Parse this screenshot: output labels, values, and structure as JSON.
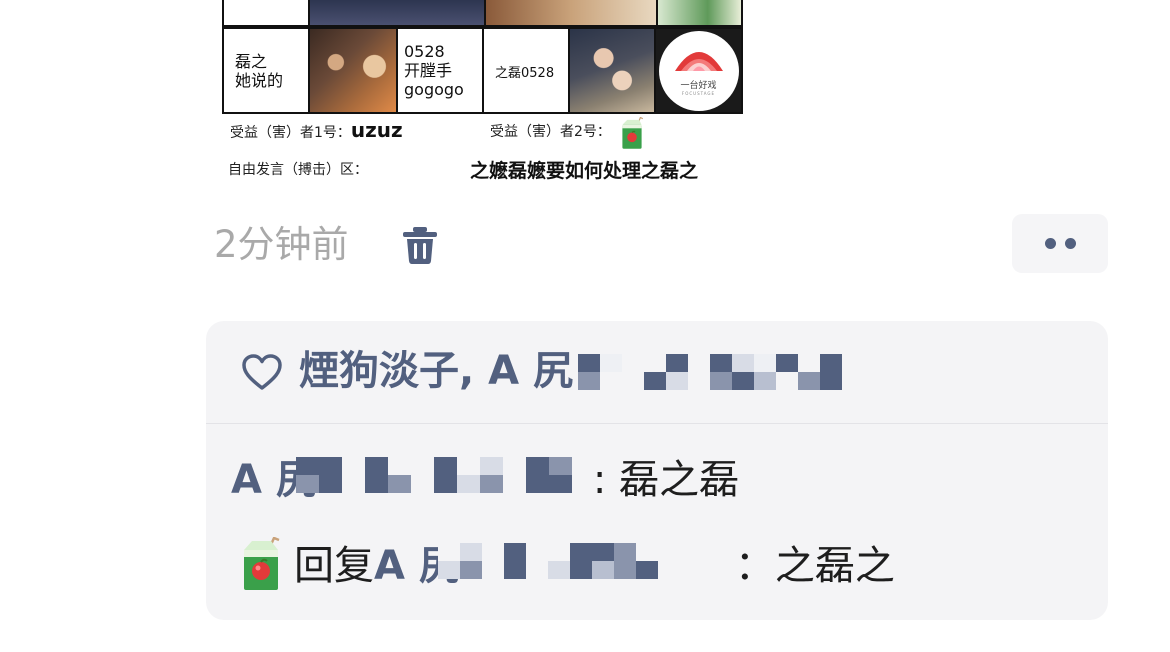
{
  "meme": {
    "cells": [
      {
        "text": "磊之\n她说的"
      },
      {
        "text": "0528\n开膛手\ngogogo"
      },
      {
        "text": "之磊0528"
      }
    ],
    "logo_name": "一台好戏",
    "logo_sub": "FOCUSTAGE",
    "beneficiary1_label": "受益（害）者1号：",
    "beneficiary1_value": "uzuz",
    "beneficiary2_label": "受益（害）者2号：",
    "free_speech_label": "自由发言（搏击）区：",
    "free_speech_text": "之嬷磊嬷要如何处理之磊之"
  },
  "post_meta": {
    "time": "2分钟前",
    "delete_icon": "trash-icon",
    "more_icon": "more-dots-icon"
  },
  "likes": {
    "icon": "heart-outline-icon",
    "names_visible": "煙狗淡子, A 尻"
  },
  "comments": [
    {
      "user_visible": "A 尻",
      "text": ": 磊之磊"
    },
    {
      "avatar": "juice-box-icon",
      "reply_word": "回复",
      "user_visible": "A 尻",
      "text": "：之磊之"
    }
  ],
  "colors": {
    "link": "#52607f",
    "panel_bg": "#f4f4f6",
    "time_text": "#a9a9a9"
  }
}
